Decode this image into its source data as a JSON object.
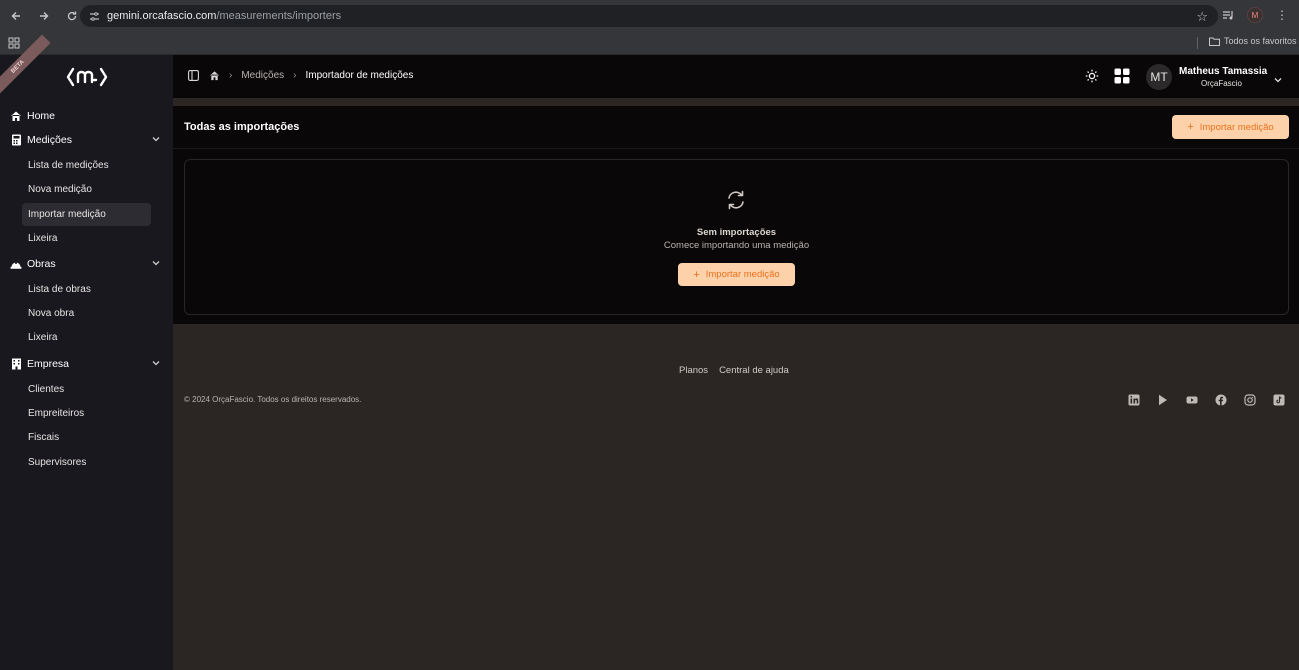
{
  "browser": {
    "url_host": "gemini.orcafascio.com",
    "url_path": "/measurements/importers",
    "profile_initial": "M",
    "bookmarks_folder": "Todos os favoritos"
  },
  "sidebar": {
    "badge": "BETA",
    "home": "Home",
    "groups": [
      {
        "label": "Medições",
        "items": [
          "Lista de medições",
          "Nova medição",
          "Importar medição",
          "Lixeira"
        ]
      },
      {
        "label": "Obras",
        "items": [
          "Lista de obras",
          "Nova obra",
          "Lixeira"
        ]
      },
      {
        "label": "Empresa",
        "items": [
          "Clientes",
          "Empreiteiros",
          "Fiscais",
          "Supervisores"
        ]
      }
    ],
    "active_item": "Importar medição"
  },
  "header": {
    "breadcrumb": [
      "Medições",
      "Importador de medições"
    ],
    "user": {
      "initials": "MT",
      "name": "Matheus Tamassia",
      "org": "OrçaFascio"
    }
  },
  "main": {
    "title": "Todas as importações",
    "import_button": "Importar medição",
    "empty": {
      "title": "Sem importações",
      "subtitle": "Comece importando uma medição",
      "button": "Importar medição"
    }
  },
  "footer": {
    "links": [
      "Planos",
      "Central de ajuda"
    ],
    "copyright": "© 2024 OrçaFascio. Todos os direitos reservados.",
    "socials": [
      "linkedin-icon",
      "google-play-icon",
      "youtube-icon",
      "facebook-icon",
      "instagram-icon",
      "tiktok-icon"
    ]
  },
  "colors": {
    "accent_bg": "#fdd2ab",
    "accent_text": "#e8711d",
    "sidebar_bg": "#1a181f",
    "panel_bg": "#0a0708",
    "page_bg": "#2b2624"
  }
}
